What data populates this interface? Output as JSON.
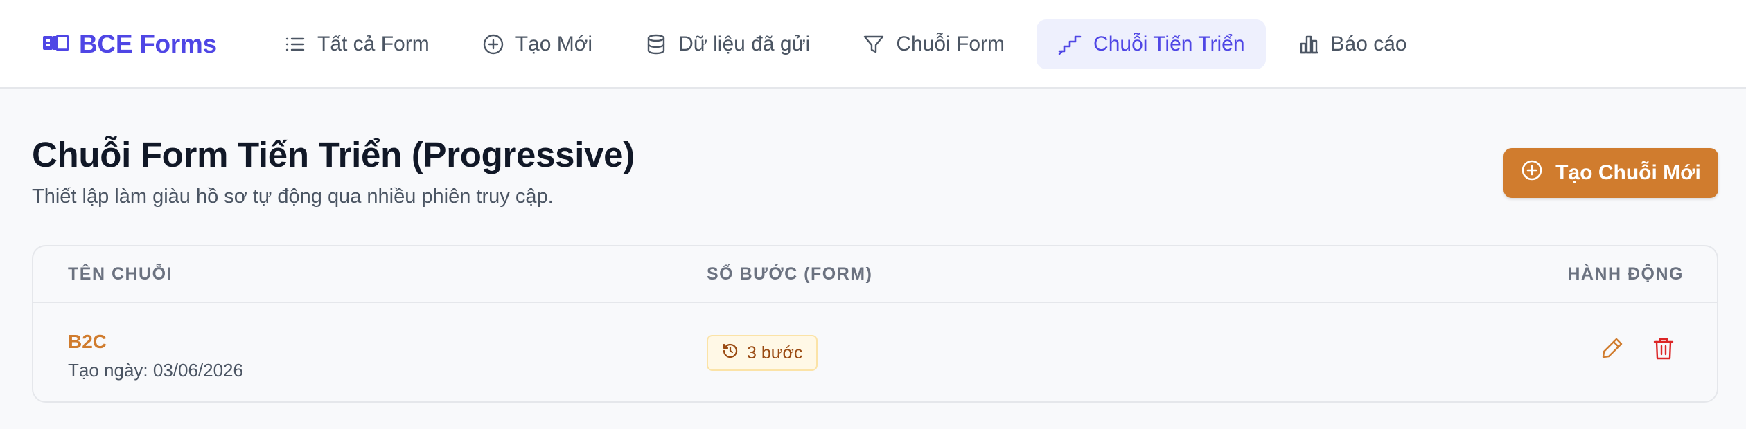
{
  "brand": {
    "name": "BCE Forms",
    "icon": "book-open-icon",
    "color": "#4f46e5"
  },
  "nav": {
    "items": [
      {
        "label": "Tất cả Form",
        "icon": "list-icon",
        "active": false
      },
      {
        "label": "Tạo Mới",
        "icon": "plus-circle-icon",
        "active": false
      },
      {
        "label": "Dữ liệu đã gửi",
        "icon": "database-icon",
        "active": false
      },
      {
        "label": "Chuỗi Form",
        "icon": "filter-icon",
        "active": false
      },
      {
        "label": "Chuỗi Tiến Triển",
        "icon": "stairs-icon",
        "active": true
      },
      {
        "label": "Báo cáo",
        "icon": "bar-chart-icon",
        "active": false
      }
    ]
  },
  "page": {
    "title": "Chuỗi Form Tiến Triển (Progressive)",
    "subtitle": "Thiết lập làm giàu hồ sơ tự động qua nhiều phiên truy cập.",
    "create_button": {
      "label": "Tạo Chuỗi Mới",
      "icon": "plus-circle-icon",
      "color": "#d07c2e"
    }
  },
  "table": {
    "headers": {
      "name": "TÊN CHUỖI",
      "steps": "SỐ BƯỚC (FORM)",
      "actions": "HÀNH ĐỘNG"
    },
    "rows": [
      {
        "name": "B2C",
        "created": "Tạo ngày: 03/06/2026",
        "steps": "3 bước",
        "steps_icon": "history-icon",
        "actions": [
          "pencil-icon",
          "trash-icon"
        ]
      }
    ]
  },
  "colors": {
    "accent": "#4f46e5",
    "orange": "#d07c2e",
    "danger": "#dc2626"
  }
}
